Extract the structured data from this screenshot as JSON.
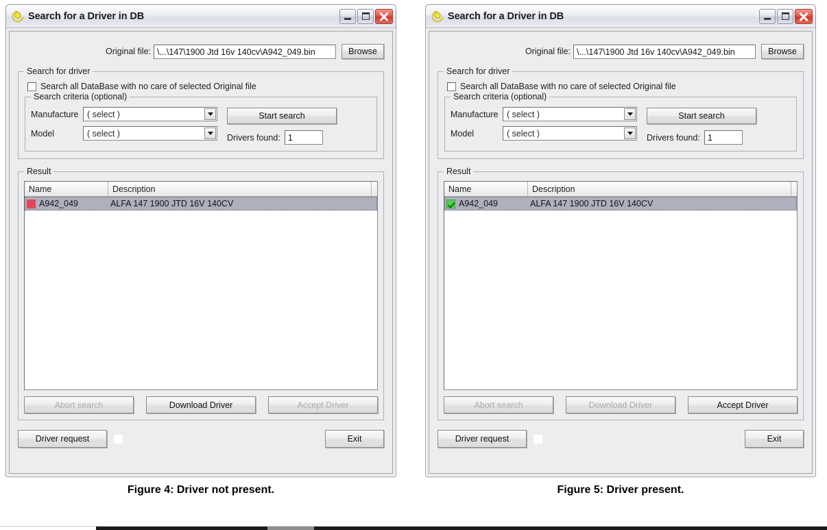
{
  "figures": [
    {
      "id": "left",
      "caption": "Figure 4: Driver not present.",
      "window": {
        "title": "Search for a Driver in DB",
        "icon": "app-swirl-icon",
        "buttons": {
          "minimize": "Minimize",
          "maximize": "Maximize",
          "close": "Close"
        }
      },
      "file_row": {
        "label": "Original file:",
        "value": "\\...\\147\\1900 Jtd 16v 140cv\\A942_049.bin",
        "browse_label": "Browse"
      },
      "search_group": {
        "legend": "Search for driver",
        "search_all_label": "Search all DataBase with no care of selected Original file",
        "search_all_checked": false,
        "criteria": {
          "legend": "Search criteria (optional)",
          "manufacture_label": "Manufacture",
          "manufacture_value": "( select )",
          "model_label": "Model",
          "model_value": "( select )",
          "start_search_label": "Start search",
          "drivers_found_label": "Drivers found:",
          "drivers_found_value": "1"
        }
      },
      "result_group": {
        "legend": "Result",
        "columns": [
          "Name",
          "Description"
        ],
        "rows": [
          {
            "status": "red",
            "status_icon": "red-square-icon",
            "name": "A942_049",
            "description": "ALFA 147 1900 JTD 16V 140CV",
            "selected": true
          }
        ],
        "actions": [
          {
            "label": "Abort search",
            "enabled": false
          },
          {
            "label": "Download Driver",
            "enabled": true
          },
          {
            "label": "Accept Driver",
            "enabled": false
          }
        ]
      },
      "footer": {
        "driver_request_label": "Driver request",
        "led": "white",
        "exit_label": "Exit"
      }
    },
    {
      "id": "right",
      "caption": "Figure 5: Driver present.",
      "window": {
        "title": "Search for a Driver in DB",
        "icon": "app-swirl-icon",
        "buttons": {
          "minimize": "Minimize",
          "maximize": "Maximize",
          "close": "Close"
        }
      },
      "file_row": {
        "label": "Original file:",
        "value": "\\...\\147\\1900 Jtd 16v 140cv\\A942_049.bin",
        "browse_label": "Browse"
      },
      "search_group": {
        "legend": "Search for driver",
        "search_all_label": "Search all DataBase with no care of selected Original file",
        "search_all_checked": false,
        "criteria": {
          "legend": "Search criteria (optional)",
          "manufacture_label": "Manufacture",
          "manufacture_value": "( select )",
          "model_label": "Model",
          "model_value": "( select )",
          "start_search_label": "Start search",
          "drivers_found_label": "Drivers found:",
          "drivers_found_value": "1"
        }
      },
      "result_group": {
        "legend": "Result",
        "columns": [
          "Name",
          "Description"
        ],
        "rows": [
          {
            "status": "green",
            "status_icon": "green-check-icon",
            "name": "A942_049",
            "description": "ALFA 147 1900 JTD 16V 140CV",
            "selected": true
          }
        ],
        "actions": [
          {
            "label": "Abort search",
            "enabled": false
          },
          {
            "label": "Download Driver",
            "enabled": false
          },
          {
            "label": "Accept Driver",
            "enabled": true
          }
        ]
      },
      "footer": {
        "driver_request_label": "Driver request",
        "led": "white",
        "exit_label": "Exit"
      }
    }
  ],
  "colors": {
    "status_red": "#e2455a",
    "status_green": "#4fd14f",
    "selection": "#aeb0be",
    "window_face": "#edecee",
    "close_button": "#cf3a2c"
  }
}
